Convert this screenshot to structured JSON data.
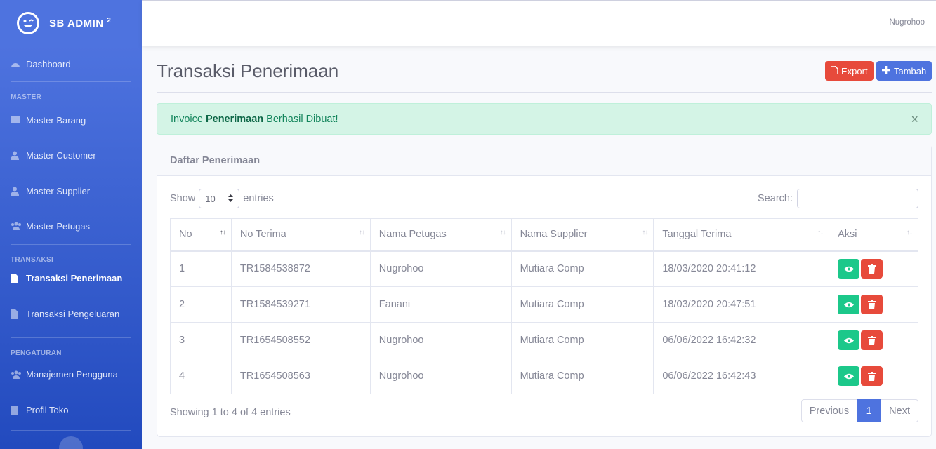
{
  "sidebar": {
    "brand": "SB ADMIN",
    "brand_sup": "2",
    "dashboard": "Dashboard",
    "heading_master": "MASTER",
    "master_items": [
      "Master Barang",
      "Master Customer",
      "Master Supplier",
      "Master Petugas"
    ],
    "heading_transaksi": "TRANSAKSI",
    "transaksi_items": [
      "Transaksi Penerimaan",
      "Transaksi Pengeluaran"
    ],
    "heading_pengaturan": "PENGATURAN",
    "pengaturan_items": [
      "Manajemen Pengguna",
      "Profil Toko"
    ]
  },
  "topbar": {
    "user": "Nugrohoo"
  },
  "page": {
    "title": "Transaksi Penerimaan",
    "export_label": "Export",
    "tambah_label": "Tambah"
  },
  "alert": {
    "prefix": "Invoice",
    "strong": "Penerimaan",
    "suffix": "Berhasil Dibuat!",
    "close": "×"
  },
  "card": {
    "header": "Daftar Penerimaan",
    "show_label": "Show",
    "entries_label": "entries",
    "page_length": "10",
    "search_label": "Search:",
    "columns": [
      "No",
      "No Terima",
      "Nama Petugas",
      "Nama Supplier",
      "Tanggal Terima",
      "Aksi"
    ],
    "rows": [
      [
        "1",
        "TR1584538872",
        "Nugrohoo",
        "Mutiara Comp",
        "18/03/2020 20:41:12"
      ],
      [
        "2",
        "TR1584539271",
        "Fanani",
        "Mutiara Comp",
        "18/03/2020 20:47:51"
      ],
      [
        "3",
        "TR1654508552",
        "Nugrohoo",
        "Mutiara Comp",
        "06/06/2022 16:42:32"
      ],
      [
        "4",
        "TR1654508563",
        "Nugrohoo",
        "Mutiara Comp",
        "06/06/2022 16:42:43"
      ]
    ],
    "info": "Showing 1 to 4 of 4 entries",
    "pagination": {
      "previous": "Previous",
      "current": "1",
      "next": "Next"
    }
  },
  "colors": {
    "primary": "#4e73df",
    "success": "#1cc88a",
    "danger": "#e74a3b"
  }
}
